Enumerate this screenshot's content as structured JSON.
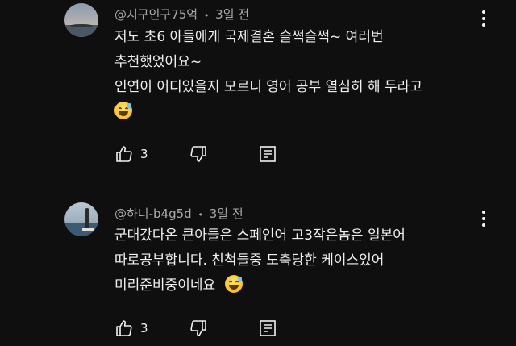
{
  "comments": [
    {
      "author": "@지구인구75억",
      "separator": "•",
      "time": "3일 전",
      "lines": [
        "저도 초6 아들에게 국제결혼 슬쩍슬쩍~ 여러번",
        "추천했었어요~",
        "인연이 어디있을지 모르니 영어 공부 열심히 해 두라고"
      ],
      "emoji": "grinning-sweat-emoji",
      "likes": "3"
    },
    {
      "author": "@하니-b4g5d",
      "separator": "•",
      "time": "3일 전",
      "lines": [
        "군대갔다온 큰아들은 스페인어 고3작은놈은 일본어",
        "따로공부합니다. 친척들중 도축당한 케이스있어",
        "미리준비중이네요"
      ],
      "emoji": "grinning-sweat-emoji",
      "likes": "3"
    }
  ],
  "icons": {
    "like": "thumbs-up-icon",
    "dislike": "thumbs-down-icon",
    "reply": "reply-icon",
    "more": "more-vertical-icon"
  }
}
